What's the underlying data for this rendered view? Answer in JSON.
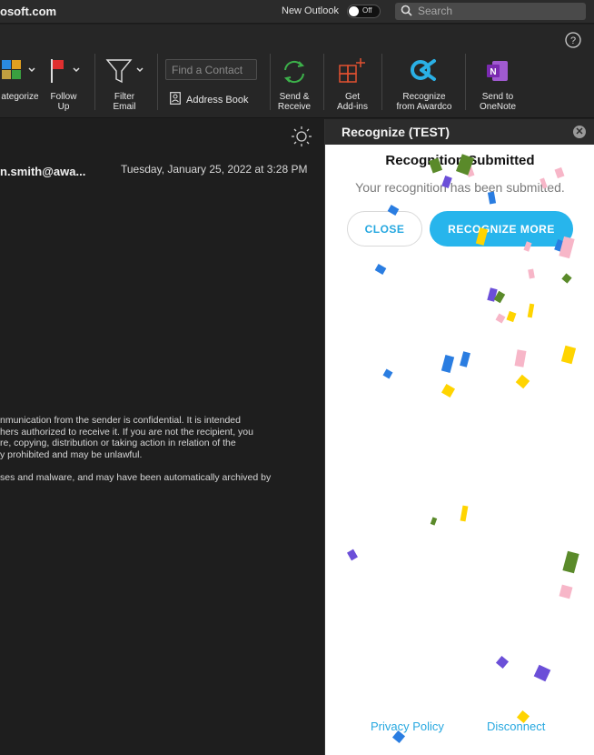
{
  "titlebar": {
    "app_title": "osoft.com",
    "new_outlook_label": "New Outlook",
    "toggle_state": "Off",
    "search_placeholder": "Search"
  },
  "ribbon": {
    "buttons": [
      {
        "label": "ategorize"
      },
      {
        "label": "Follow\nUp"
      },
      {
        "label": "Filter\nEmail"
      },
      {
        "label": "Send &\nReceive"
      },
      {
        "label": "Get\nAdd-ins"
      },
      {
        "label": "Recognize\nfrom Awardco"
      },
      {
        "label": "Send to\nOneNote"
      }
    ],
    "find_contact_placeholder": "Find a Contact",
    "address_book_label": "Address Book"
  },
  "message": {
    "sender": "n.smith@awa...",
    "date": "Tuesday, January 25, 2022 at 3:28 PM",
    "disclaimer_lines": [
      "nmunication from the sender is confidential. It is intended",
      "hers authorized to receive it. If you are not the recipient, you",
      "re, copying, distribution or taking action in relation of the",
      "y prohibited and may be unlawful."
    ],
    "scan_note": "ses and malware, and may have been automatically archived by"
  },
  "addin": {
    "title": "Recognize (TEST)",
    "success_title": "Recognition Submitted",
    "success_message": "Your recognition has been submitted.",
    "close_label": "CLOSE",
    "recognize_more_label": "RECOGNIZE MORE",
    "privacy_label": "Privacy Policy",
    "disconnect_label": "Disconnect"
  },
  "colors": {
    "accent": "#27b5ec",
    "link": "#27a8e0",
    "confetti": [
      "#2a7de1",
      "#ffd400",
      "#f7b6c8",
      "#6b4fd8",
      "#5a8a2a"
    ]
  },
  "icons": [
    "search-icon",
    "help-icon",
    "categorize-icon",
    "flag-icon",
    "filter-icon",
    "address-book-icon",
    "sync-icon",
    "add-ins-icon",
    "awardco-icon",
    "onenote-icon",
    "sun-icon",
    "close-icon"
  ]
}
